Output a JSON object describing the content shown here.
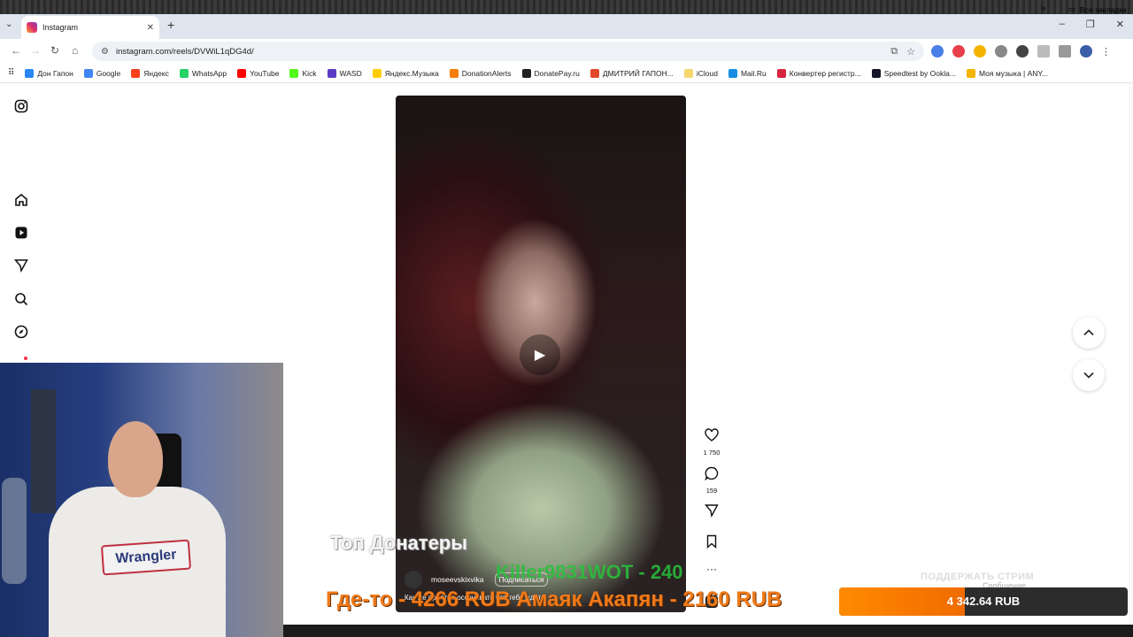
{
  "browser": {
    "tab_title": "Instagram",
    "url": "instagram.com/reels/DVWiL1qDG4d/",
    "bookmarks": [
      {
        "label": "Дон Гапон",
        "color": "#2787f5"
      },
      {
        "label": "Google",
        "color": "#4285f4"
      },
      {
        "label": "Яндекс",
        "color": "#fc3f1d"
      },
      {
        "label": "WhatsApp",
        "color": "#25d366"
      },
      {
        "label": "YouTube",
        "color": "#ff0000"
      },
      {
        "label": "Kick",
        "color": "#53fc18"
      },
      {
        "label": "WASD",
        "color": "#5b3cc4"
      },
      {
        "label": "Яндекс.Музыка",
        "color": "#ffcc00"
      },
      {
        "label": "DonationAlerts",
        "color": "#f57d07"
      },
      {
        "label": "DonatePay.ru",
        "color": "#222222"
      },
      {
        "label": "ДМИТРИЙ ГАПОН...",
        "color": "#e2462b"
      },
      {
        "label": "iCloud",
        "color": "#f5d76e"
      },
      {
        "label": "Mail.Ru",
        "color": "#168de2"
      },
      {
        "label": "Конвертер регистр...",
        "color": "#d7263d"
      },
      {
        "label": "Speedtest by Ookla...",
        "color": "#141526"
      },
      {
        "label": "Моя музыка | ANY...",
        "color": "#f4b400"
      }
    ],
    "all_bookmarks": "Все закладки"
  },
  "reel": {
    "username": "moseevskixvika",
    "follow_label": "Подписаться",
    "caption": "Как же приятно осознавать что тебя ждут и ...",
    "likes": "1 750",
    "comments": "159"
  },
  "stream_overlay": {
    "top_donators_title": "Топ Донатеры",
    "recent_donation": "Killer9831WOT - 240",
    "top_line": "Где-то - 4266 RUB    Амаяк Акапян - 2160 RUB",
    "support_label": "ПОДДЕРЖАТЬ СТРИМ",
    "message_label": "Сообщение",
    "goal_amount": "4 342.64 RUB",
    "goal_min": "0",
    "goal_max": "10 000",
    "goal_progress": 0.4343
  },
  "webcam": {
    "shirt_logo": "Wrangler"
  }
}
